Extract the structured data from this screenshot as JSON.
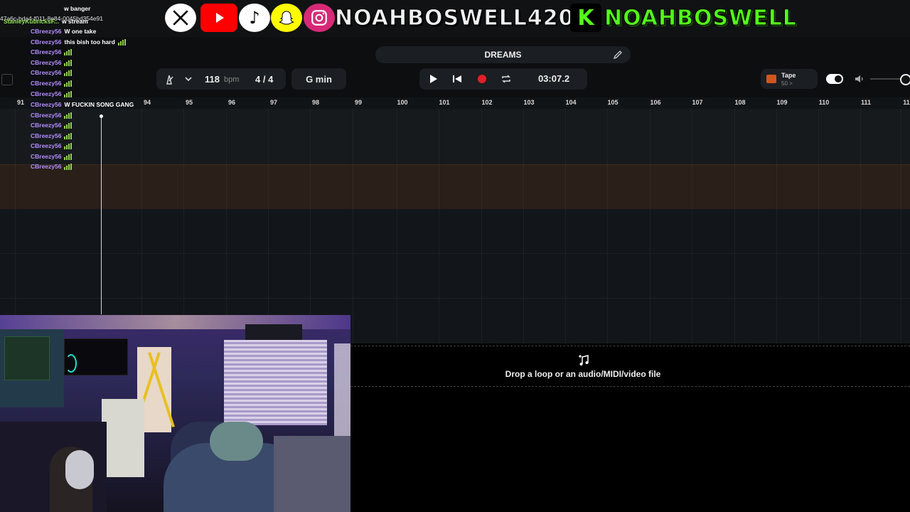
{
  "overlay": {
    "handle_main": "NOAHBOSWELL420",
    "handle_kick": "NOAHBOSWELL",
    "kick_letter": "K",
    "colors": {
      "x": "#000000",
      "youtube": "#ff0000",
      "tiktok": "#000000",
      "snapchat": "#fffc00",
      "instagram": "#d62976",
      "kick": "#53fc18"
    }
  },
  "chat": {
    "lines": [
      {
        "user": "",
        "msg": "w banger"
      },
      {
        "user": "47a6c-bda4-f011-8e84-0045bd354e91",
        "msg": ""
      },
      {
        "user": "StanleyKubricksF...",
        "msg": "w stream"
      },
      {
        "user": "CBreezy56",
        "msg": "W one take"
      },
      {
        "user": "CBreezy56",
        "msg": "this bish too hard"
      },
      {
        "user": "CBreezy56",
        "msg": ""
      },
      {
        "user": "CBreezy56",
        "msg": ""
      },
      {
        "user": "CBreezy56",
        "msg": ""
      },
      {
        "user": "CBreezy56",
        "msg": ""
      },
      {
        "user": "CBreezy56",
        "msg": ""
      },
      {
        "user": "CBreezy56",
        "msg": "W FUCKIN SONG GANG"
      },
      {
        "user": "CBreezy56",
        "msg": ""
      },
      {
        "user": "CBreezy56",
        "msg": ""
      },
      {
        "user": "CBreezy56",
        "msg": ""
      },
      {
        "user": "CBreezy56",
        "msg": ""
      },
      {
        "user": "CBreezy56",
        "msg": ""
      },
      {
        "user": "CBreezy56",
        "msg": ""
      }
    ]
  },
  "project": {
    "title": "DREAMS"
  },
  "transport": {
    "bpm_value": "118",
    "bpm_unit": "bpm",
    "time_sig": "4 / 4",
    "key": "G min",
    "time": "03:07.2"
  },
  "tape": {
    "label": "Tape",
    "sub": "50 >"
  },
  "ruler": {
    "ticks": [
      "91",
      "94",
      "95",
      "96",
      "97",
      "98",
      "99",
      "100",
      "101",
      "102",
      "103",
      "104",
      "105",
      "106",
      "107",
      "108",
      "109",
      "110",
      "111",
      "11"
    ]
  },
  "dropzone": {
    "text": "Drop a loop or an audio/MIDI/video file"
  },
  "colors": {
    "bg": "#0c0e10",
    "track_orange": "#2a2019",
    "record": "#e0202a",
    "chat_user": "#b48cff"
  }
}
